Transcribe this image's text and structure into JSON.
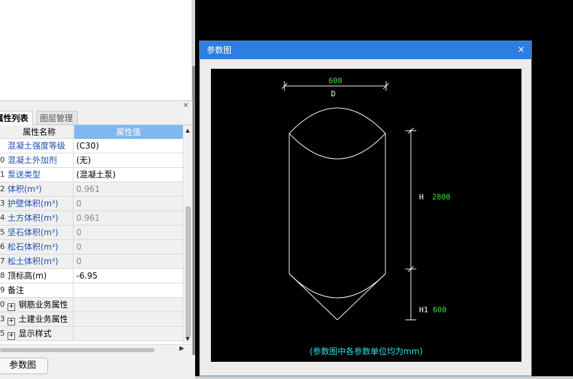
{
  "tabs": {
    "attr_list": "属性列表",
    "layer_mgmt": "图层管理"
  },
  "close_x": "×",
  "table": {
    "header_name": "属性名称",
    "header_value": "属性值",
    "rows": [
      {
        "num": "",
        "name": "混凝土强度等级",
        "value": "(C30)"
      },
      {
        "num": "0",
        "name": "混凝土外加剂",
        "value": "(无)"
      },
      {
        "num": "1",
        "name": "泵送类型",
        "value": "(混凝土泵)"
      },
      {
        "num": "2",
        "name": "体积(m³)",
        "value": "0.961"
      },
      {
        "num": "3",
        "name": "护壁体积(m³)",
        "value": "0"
      },
      {
        "num": "4",
        "name": "土方体积(m³)",
        "value": "0.961"
      },
      {
        "num": "5",
        "name": "坚石体积(m³)",
        "value": "0"
      },
      {
        "num": "6",
        "name": "松石体积(m³)",
        "value": "0"
      },
      {
        "num": "7",
        "name": "松土体积(m³)",
        "value": "0"
      },
      {
        "num": "8",
        "name": "顶标高(m)",
        "value": "-6.95"
      },
      {
        "num": "9",
        "name": "备注",
        "value": ""
      },
      {
        "num": "0",
        "name": "钢筋业务属性",
        "value": ""
      },
      {
        "num": "3",
        "name": "土建业务属性",
        "value": ""
      },
      {
        "num": "5",
        "name": "显示样式",
        "value": ""
      }
    ]
  },
  "bottom_button": "参数图",
  "dialog": {
    "title": "参数图",
    "close": "×",
    "drawing": {
      "d_value": "600",
      "d_label": "D",
      "h_label": "H",
      "h_value": "2800",
      "h1_label": "H1",
      "h1_value": "600",
      "note": "(参数图中各参数单位均为mm)"
    }
  },
  "colors": {
    "title_bar": "#2c7fe0",
    "header_value_bg": "#7fb8ef",
    "link_blue": "#1e4fb4",
    "dim_green": "#37e637",
    "note_cyan": "#2ee0e6"
  }
}
